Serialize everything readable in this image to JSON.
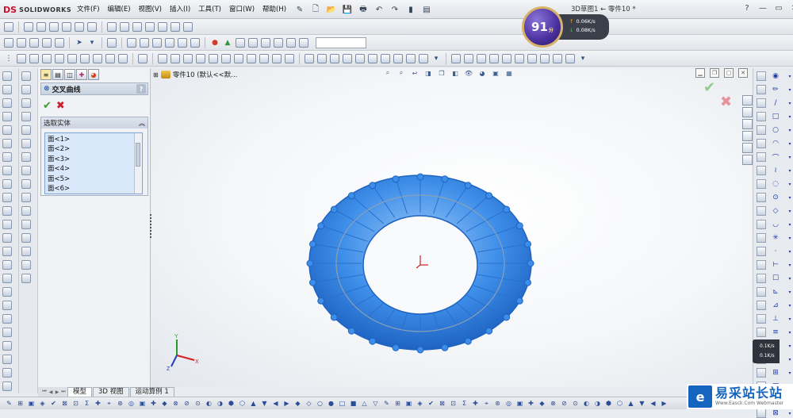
{
  "app": {
    "brand_prefix": "DS",
    "brand": "SOLIDWORKS"
  },
  "menu": [
    "文件(F)",
    "编辑(E)",
    "视图(V)",
    "插入(I)",
    "工具(T)",
    "窗口(W)",
    "帮助(H)"
  ],
  "document_title": "3D草图1 ← 零件10 *",
  "window_controls": {
    "help": "?",
    "minimize": "—",
    "restore": "▭",
    "close": "✕"
  },
  "speed_widget": {
    "percent": "91",
    "unit": "分",
    "upload": "0.06K/s",
    "download": "0.08K/s"
  },
  "small_speed": {
    "upload": "0.1K/s",
    "download": "0.1K/s"
  },
  "property_manager": {
    "title": "交叉曲线",
    "help": "?",
    "ok": "✔",
    "cancel": "✖",
    "section_title": "选取实体",
    "collapse": "︽",
    "selections": [
      "面<1>",
      "面<2>",
      "面<3>",
      "面<4>",
      "面<5>",
      "面<6>"
    ]
  },
  "tree": {
    "expand": "⊞",
    "part_label": "零件10 (默认<<默..."
  },
  "triad": {
    "x": "X",
    "y": "Y",
    "z": "Z"
  },
  "bottom_tabs": {
    "model": "模型",
    "view3d": "3D 视图",
    "motion": "运动算例 1"
  },
  "watermark": {
    "cn": "易采站长站",
    "en": "Www.Easck.Com Webmaster"
  },
  "colors": {
    "torus": "#3d8ee8",
    "torus_edge": "#1f63c2",
    "accent": "#c8102e"
  }
}
